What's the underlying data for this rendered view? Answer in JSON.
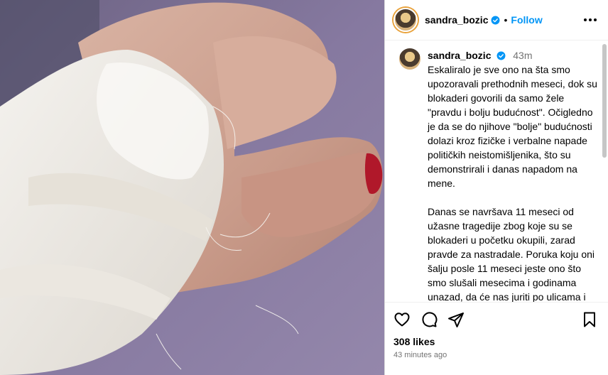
{
  "post": {
    "username": "sandra_bozic",
    "follow_label": "Follow",
    "separator": "•",
    "time_short": "43m",
    "caption": "Eskaliralo je sve ono na šta smo upozoravali prethodnih meseci, dok su blokaderi govorili da samo žele \"pravdu i bolju budućnost\". Očigledno je da se do njihove \"bolje\" budućnosti dolazi kroz fizičke i verbalne napade političkih neistomišljenika, što su demonstrirali i danas napadom na mene.\n\nDanas se navršava 11 meseci od užasne tragedije zbog koje su se blokaderi u početku okupili, zarad pravde za nastradale. Poruka koju oni šalju posle 11 meseci jeste ono što smo slušali mesecima i godinama unazad, da će nas juriti po ulicama i da će svako imati svog naprednjaka.\n\nTakve ljude su načinili svojim herojima i kroz njihove medije ih prikazuju kao",
    "likes": "308 likes",
    "time_long": "43 minutes ago"
  },
  "icons": {
    "heart": "heart-icon",
    "comment": "comment-icon",
    "share": "share-icon",
    "save": "bookmark-icon",
    "verified": "verified-icon",
    "more": "more-icon"
  },
  "colors": {
    "accent": "#0095f6",
    "muted": "#737373",
    "photo_background": "#7d6f92",
    "nail": "#b0182a"
  }
}
